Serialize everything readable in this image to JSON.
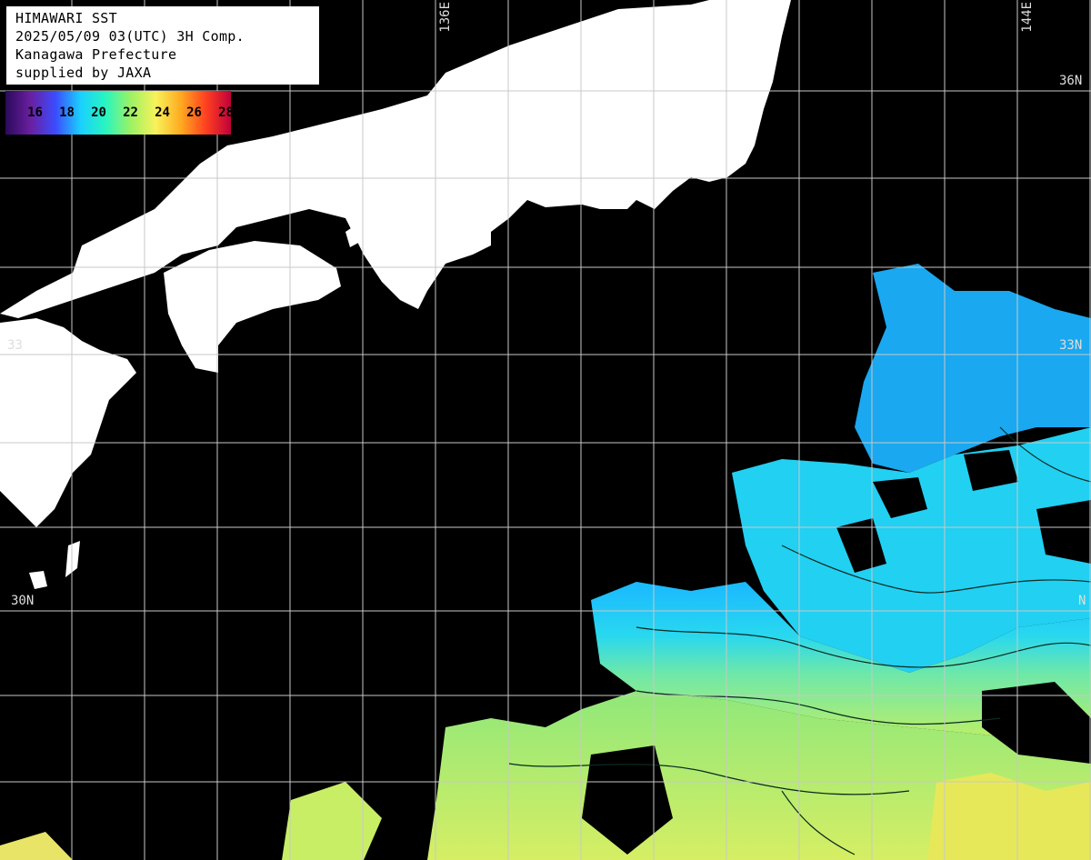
{
  "info": {
    "line1": "HIMAWARI SST",
    "line2": "2025/05/09 03(UTC) 3H Comp.",
    "line3": "Kanagawa Prefecture",
    "line4": "supplied by JAXA"
  },
  "legend": {
    "ticks": [
      "16",
      "18",
      "20",
      "22",
      "24",
      "26",
      "28"
    ],
    "colors": [
      "#2a0a5a",
      "#6a1fa0",
      "#3b4cff",
      "#1ad0ff",
      "#29f5c0",
      "#9df264",
      "#f8f25a",
      "#ffaa20",
      "#ff4020",
      "#c0003a"
    ]
  },
  "grid_labels": {
    "lon_136": "136E",
    "lon_144": "144E",
    "lat_36": "36N",
    "lat_33_right": "33N",
    "lat_33_left": "33",
    "lat_30_left": "30N",
    "lat_30_right": "N"
  },
  "colors": {
    "land": "#ffffff",
    "ocean_nodata": "#000000",
    "grid": "#c8c8c8"
  }
}
